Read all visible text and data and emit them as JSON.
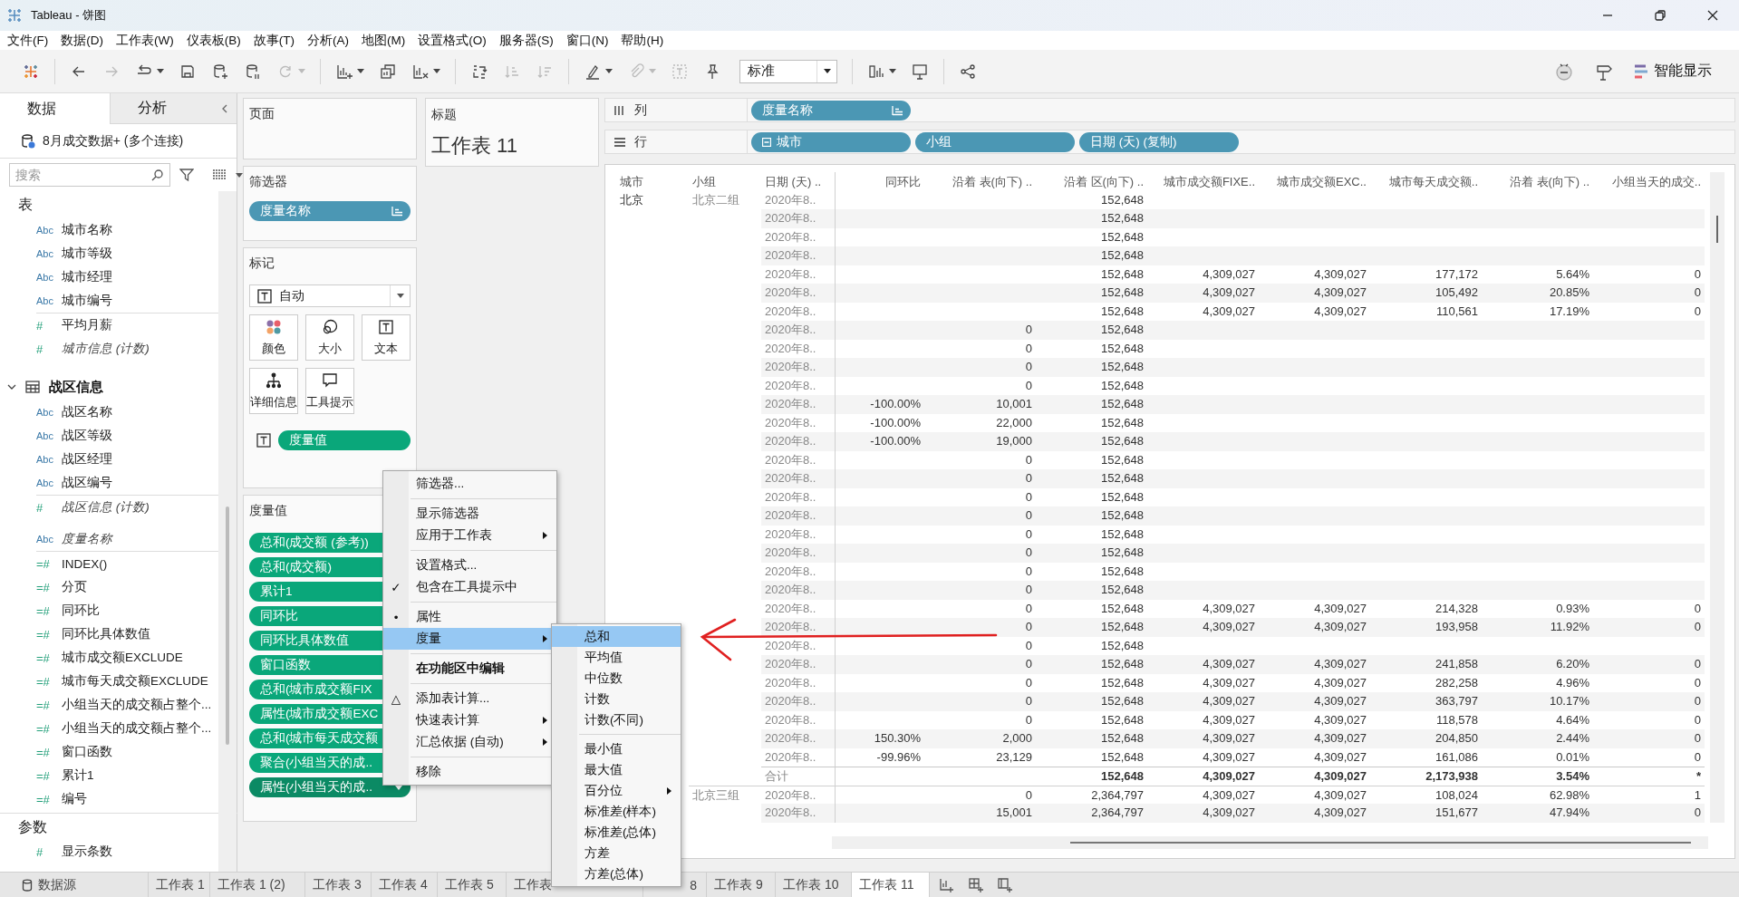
{
  "window": {
    "title": "Tableau - 饼图"
  },
  "menu": [
    "文件(F)",
    "数据(D)",
    "工作表(W)",
    "仪表板(B)",
    "故事(T)",
    "分析(A)",
    "地图(M)",
    "设置格式(O)",
    "服务器(S)",
    "窗口(N)",
    "帮助(H)"
  ],
  "toolbar": {
    "buttons": [
      {
        "disabled": false
      },
      {
        "disabled": true
      },
      {
        "disabled": false
      },
      {
        "disabled": false
      },
      {
        "disabled": false
      },
      {
        "disabled": false
      },
      {
        "disabled": true
      },
      {
        "disabled": false
      },
      {
        "disabled": false
      },
      {
        "disabled": false
      },
      {
        "disabled": false
      },
      {
        "disabled": true
      },
      {
        "disabled": true
      },
      {
        "disabled": false
      },
      {
        "disabled": true
      },
      {
        "disabled": true
      },
      {
        "disabled": false
      },
      {
        "disabled": false
      },
      {
        "disabled": false
      },
      {
        "disabled": false
      }
    ],
    "fit": "标准",
    "show_me": "智能显示"
  },
  "data_pane": {
    "tabs": [
      {
        "label": "数据",
        "selected": true
      },
      {
        "label": "分析",
        "selected": false
      }
    ],
    "source": "8月成交数据+ (多个连接)",
    "search": {
      "placeholder": "搜索"
    },
    "sections": [
      {
        "kind": "heading",
        "title": "表",
        "groups": [
          [
            {
              "icon": "Abc",
              "label": "城市名称",
              "kind": "dimension",
              "generated": false
            },
            {
              "icon": "Abc",
              "label": "城市等级",
              "kind": "dimension",
              "generated": false
            },
            {
              "icon": "Abc",
              "label": "城市经理",
              "kind": "dimension",
              "generated": false
            },
            {
              "icon": "Abc",
              "label": "城市编号",
              "kind": "dimension",
              "generated": false
            }
          ],
          [
            {
              "icon": "#",
              "label": "平均月薪",
              "kind": "measure",
              "generated": false
            },
            {
              "icon": "#",
              "label": "城市信息 (计数)",
              "kind": "measure",
              "generated": true
            }
          ]
        ]
      },
      {
        "kind": "folder",
        "title": "战区信息",
        "expanded": true,
        "groups": [
          [
            {
              "icon": "Abc",
              "label": "战区名称",
              "kind": "dimension",
              "generated": false
            },
            {
              "icon": "Abc",
              "label": "战区等级",
              "kind": "dimension",
              "generated": false
            },
            {
              "icon": "Abc",
              "label": "战区经理",
              "kind": "dimension",
              "generated": false
            },
            {
              "icon": "Abc",
              "label": "战区编号",
              "kind": "dimension",
              "generated": false
            }
          ],
          [
            {
              "icon": "#",
              "label": "战区信息 (计数)",
              "kind": "measure",
              "generated": true
            }
          ]
        ]
      },
      {
        "kind": "plain",
        "groups": [
          [
            {
              "icon": "Abc",
              "label": "度量名称",
              "kind": "dimension",
              "generated": true
            }
          ],
          [
            {
              "icon": "=#",
              "label": "INDEX()",
              "kind": "measure",
              "generated": false
            },
            {
              "icon": "=#",
              "label": "分页",
              "kind": "measure",
              "generated": false
            },
            {
              "icon": "=#",
              "label": "同环比",
              "kind": "measure",
              "generated": false
            },
            {
              "icon": "=#",
              "label": "同环比具体数值",
              "kind": "measure",
              "generated": false
            },
            {
              "icon": "=#",
              "label": "城市成交额EXCLUDE",
              "kind": "measure",
              "generated": false
            },
            {
              "icon": "=#",
              "label": "城市每天成交额EXCLUDE",
              "kind": "measure",
              "generated": false
            },
            {
              "icon": "=#",
              "label": "小组当天的成交额占整个...",
              "kind": "measure",
              "generated": false
            },
            {
              "icon": "=#",
              "label": "小组当天的成交额占整个...",
              "kind": "measure",
              "generated": false
            },
            {
              "icon": "=#",
              "label": "窗口函数",
              "kind": "measure",
              "generated": false
            },
            {
              "icon": "=#",
              "label": "累计1",
              "kind": "measure",
              "generated": false
            },
            {
              "icon": "=#",
              "label": "编号",
              "kind": "measure",
              "generated": false
            }
          ]
        ]
      },
      {
        "kind": "heading",
        "title": "参数",
        "groups": [
          [
            {
              "icon": "#",
              "label": "显示条数",
              "kind": "measure",
              "generated": false
            }
          ]
        ]
      }
    ]
  },
  "shelf_cards": {
    "pages": {
      "title": "页面"
    },
    "filters": {
      "title": "筛选器",
      "pills": [
        {
          "label": "度量名称",
          "kind": "discrete",
          "sorted": true
        }
      ]
    },
    "marks": {
      "title": "标记",
      "mark_type": "自动",
      "buttons": [
        {
          "label": "颜色",
          "kind": "color"
        },
        {
          "label": "大小",
          "kind": "size"
        },
        {
          "label": "文本",
          "kind": "text"
        },
        {
          "label": "详细信息",
          "kind": "detail"
        },
        {
          "label": "工具提示",
          "kind": "tooltip"
        }
      ],
      "encodings": [
        {
          "label": "度量值",
          "kind": "continuous"
        }
      ]
    },
    "measure_values": {
      "title": "度量值",
      "pills": [
        {
          "label": "总和(成交额 (参考))",
          "kind": "continuous",
          "selected": false
        },
        {
          "label": "总和(成交额)",
          "kind": "continuous",
          "selected": false
        },
        {
          "label": "累计1",
          "kind": "continuous",
          "selected": false
        },
        {
          "label": "同环比",
          "kind": "continuous",
          "selected": false
        },
        {
          "label": "同环比具体数值",
          "kind": "continuous",
          "selected": false
        },
        {
          "label": "窗口函数",
          "kind": "continuous",
          "selected": false
        },
        {
          "label": "总和(城市成交额FIX",
          "kind": "continuous",
          "selected": false
        },
        {
          "label": "属性(城市成交额EXC",
          "kind": "continuous",
          "selected": false
        },
        {
          "label": "总和(城市每天成交额",
          "kind": "continuous",
          "selected": false
        },
        {
          "label": "聚合(小组当天的成..",
          "kind": "continuous",
          "selected": false
        },
        {
          "label": "属性(小组当天的成..",
          "kind": "continuous",
          "selected": true
        }
      ]
    },
    "title_card": {
      "title": "标题",
      "text": "工作表 11"
    }
  },
  "shelves": [
    {
      "kind": "columns",
      "label": "列",
      "pills": [
        {
          "label": "度量名称",
          "kind": "discrete",
          "sorted": true
        }
      ]
    },
    {
      "kind": "rows",
      "label": "行",
      "pills": [
        {
          "label": "城市",
          "kind": "discrete",
          "collapsible": true
        },
        {
          "label": "小组",
          "kind": "discrete"
        },
        {
          "label": "日期 (天) (复制)",
          "kind": "discrete"
        }
      ]
    }
  ],
  "table": {
    "columns": [
      "城市",
      "小组",
      "日期 (天) ..",
      "同环比",
      "沿着 表(向下) ..",
      "沿着 区(向下) ..",
      "城市成交额FIXE..",
      "城市成交额EXC..",
      "城市每天成交额..",
      "沿着 表(向下) ..",
      "小组当天的成交.."
    ],
    "rows": [
      {
        "kind": "data",
        "cells": [
          "北京",
          "北京二组",
          "2020年8..",
          null,
          null,
          "152,648",
          null,
          null,
          null,
          null,
          null
        ]
      },
      {
        "kind": "data",
        "cells": [
          null,
          null,
          "2020年8..",
          null,
          null,
          "152,648",
          null,
          null,
          null,
          null,
          null
        ]
      },
      {
        "kind": "data",
        "cells": [
          null,
          null,
          "2020年8..",
          null,
          null,
          "152,648",
          null,
          null,
          null,
          null,
          null
        ]
      },
      {
        "kind": "data",
        "cells": [
          null,
          null,
          "2020年8..",
          null,
          null,
          "152,648",
          null,
          null,
          null,
          null,
          null
        ]
      },
      {
        "kind": "data",
        "cells": [
          null,
          null,
          "2020年8..",
          null,
          null,
          "152,648",
          "4,309,027",
          "4,309,027",
          "177,172",
          "5.64%",
          "0"
        ]
      },
      {
        "kind": "data",
        "cells": [
          null,
          null,
          "2020年8..",
          null,
          null,
          "152,648",
          "4,309,027",
          "4,309,027",
          "105,492",
          "20.85%",
          "0"
        ]
      },
      {
        "kind": "data",
        "cells": [
          null,
          null,
          "2020年8..",
          null,
          null,
          "152,648",
          "4,309,027",
          "4,309,027",
          "110,561",
          "17.19%",
          "0"
        ]
      },
      {
        "kind": "data",
        "cells": [
          null,
          null,
          "2020年8..",
          null,
          "0",
          "152,648",
          null,
          null,
          null,
          null,
          null
        ]
      },
      {
        "kind": "data",
        "cells": [
          null,
          null,
          "2020年8..",
          null,
          "0",
          "152,648",
          null,
          null,
          null,
          null,
          null
        ]
      },
      {
        "kind": "data",
        "cells": [
          null,
          null,
          "2020年8..",
          null,
          "0",
          "152,648",
          null,
          null,
          null,
          null,
          null
        ]
      },
      {
        "kind": "data",
        "cells": [
          null,
          null,
          "2020年8..",
          null,
          "0",
          "152,648",
          null,
          null,
          null,
          null,
          null
        ]
      },
      {
        "kind": "data",
        "cells": [
          null,
          null,
          "2020年8..",
          "-100.00%",
          "10,001",
          "152,648",
          null,
          null,
          null,
          null,
          null
        ]
      },
      {
        "kind": "data",
        "cells": [
          null,
          null,
          "2020年8..",
          "-100.00%",
          "22,000",
          "152,648",
          null,
          null,
          null,
          null,
          null
        ]
      },
      {
        "kind": "data",
        "cells": [
          null,
          null,
          "2020年8..",
          "-100.00%",
          "19,000",
          "152,648",
          null,
          null,
          null,
          null,
          null
        ]
      },
      {
        "kind": "data",
        "cells": [
          null,
          null,
          "2020年8..",
          null,
          "0",
          "152,648",
          null,
          null,
          null,
          null,
          null
        ]
      },
      {
        "kind": "data",
        "cells": [
          null,
          null,
          "2020年8..",
          null,
          "0",
          "152,648",
          null,
          null,
          null,
          null,
          null
        ]
      },
      {
        "kind": "data",
        "cells": [
          null,
          null,
          "2020年8..",
          null,
          "0",
          "152,648",
          null,
          null,
          null,
          null,
          null
        ]
      },
      {
        "kind": "data",
        "cells": [
          null,
          null,
          "2020年8..",
          null,
          "0",
          "152,648",
          null,
          null,
          null,
          null,
          null
        ]
      },
      {
        "kind": "data",
        "cells": [
          null,
          null,
          "2020年8..",
          null,
          "0",
          "152,648",
          null,
          null,
          null,
          null,
          null
        ]
      },
      {
        "kind": "data",
        "cells": [
          null,
          null,
          "2020年8..",
          null,
          "0",
          "152,648",
          null,
          null,
          null,
          null,
          null
        ]
      },
      {
        "kind": "data",
        "cells": [
          null,
          null,
          "2020年8..",
          null,
          "0",
          "152,648",
          null,
          null,
          null,
          null,
          null
        ]
      },
      {
        "kind": "data",
        "cells": [
          null,
          null,
          "2020年8..",
          null,
          "0",
          "152,648",
          null,
          null,
          null,
          null,
          null
        ]
      },
      {
        "kind": "data",
        "cells": [
          null,
          null,
          "2020年8..",
          null,
          "0",
          "152,648",
          "4,309,027",
          "4,309,027",
          "214,328",
          "0.93%",
          "0"
        ]
      },
      {
        "kind": "data",
        "cells": [
          null,
          null,
          "2020年8..",
          null,
          "0",
          "152,648",
          "4,309,027",
          "4,309,027",
          "193,958",
          "11.92%",
          "0"
        ]
      },
      {
        "kind": "data",
        "cells": [
          null,
          null,
          "2020年8..",
          null,
          "0",
          "152,648",
          null,
          null,
          null,
          null,
          null
        ]
      },
      {
        "kind": "data",
        "cells": [
          null,
          null,
          "2020年8..",
          null,
          "0",
          "152,648",
          "4,309,027",
          "4,309,027",
          "241,858",
          "6.20%",
          "0"
        ]
      },
      {
        "kind": "data",
        "cells": [
          null,
          null,
          "2020年8..",
          null,
          "0",
          "152,648",
          "4,309,027",
          "4,309,027",
          "282,258",
          "4.96%",
          "0"
        ]
      },
      {
        "kind": "data",
        "cells": [
          null,
          null,
          "2020年8..",
          null,
          "0",
          "152,648",
          "4,309,027",
          "4,309,027",
          "363,797",
          "10.17%",
          "0"
        ]
      },
      {
        "kind": "data",
        "cells": [
          null,
          null,
          "2020年8..",
          null,
          "0",
          "152,648",
          "4,309,027",
          "4,309,027",
          "118,578",
          "4.64%",
          "0"
        ]
      },
      {
        "kind": "data",
        "cells": [
          null,
          null,
          "2020年8..",
          "150.30%",
          "2,000",
          "152,648",
          "4,309,027",
          "4,309,027",
          "204,850",
          "2.44%",
          "0"
        ]
      },
      {
        "kind": "data",
        "cells": [
          null,
          null,
          "2020年8..",
          "-99.96%",
          "23,129",
          "152,648",
          "4,309,027",
          "4,309,027",
          "161,086",
          "0.01%",
          "0"
        ]
      },
      {
        "kind": "total",
        "cells": [
          null,
          null,
          "合计",
          null,
          null,
          "152,648",
          "4,309,027",
          "4,309,027",
          "2,173,938",
          "3.54%",
          "*"
        ]
      },
      {
        "kind": "data",
        "cells": [
          null,
          "北京三组",
          "2020年8..",
          null,
          "0",
          "2,364,797",
          "4,309,027",
          "4,309,027",
          "108,024",
          "62.98%",
          "1"
        ]
      },
      {
        "kind": "data",
        "cells": [
          null,
          null,
          "2020年8..",
          null,
          "15,001",
          "2,364,797",
          "4,309,027",
          "4,309,027",
          "151,677",
          "47.94%",
          "0"
        ]
      }
    ]
  },
  "context_menu": {
    "groups": [
      [
        {
          "label": "筛选器...",
          "selected": false
        }
      ],
      [
        {
          "label": "显示筛选器",
          "selected": false
        },
        {
          "label": "应用于工作表",
          "selected": false,
          "submenu": true
        }
      ],
      [
        {
          "label": "设置格式...",
          "selected": false
        },
        {
          "label": "包含在工具提示中",
          "selected": false,
          "icon": "✓"
        }
      ],
      [
        {
          "label": "属性",
          "selected": false,
          "icon": "•"
        },
        {
          "label": "度量",
          "selected": true,
          "submenu": true
        }
      ],
      [
        {
          "label": "在功能区中编辑",
          "selected": false,
          "bold": true
        }
      ],
      [
        {
          "label": "添加表计算...",
          "selected": false,
          "icon": "△"
        },
        {
          "label": "快速表计算",
          "selected": false,
          "submenu": true
        },
        {
          "label": "汇总依据 (自动)",
          "selected": false,
          "submenu": true
        }
      ],
      [
        {
          "label": "移除",
          "selected": false
        }
      ]
    ]
  },
  "submenu": {
    "groups": [
      [
        {
          "label": "总和",
          "selected": true
        },
        {
          "label": "平均值",
          "selected": false
        },
        {
          "label": "中位数",
          "selected": false
        },
        {
          "label": "计数",
          "selected": false
        },
        {
          "label": "计数(不同)",
          "selected": false
        }
      ],
      [
        {
          "label": "最小值",
          "selected": false
        },
        {
          "label": "最大值",
          "selected": false
        },
        {
          "label": "百分位",
          "selected": false,
          "submenu": true
        },
        {
          "label": "标准差(样本)",
          "selected": false
        },
        {
          "label": "标准差(总体)",
          "selected": false
        },
        {
          "label": "方差",
          "selected": false
        },
        {
          "label": "方差(总体)",
          "selected": false
        }
      ]
    ]
  },
  "sheet_tabs": [
    {
      "label": "数据源",
      "kind": "datasource",
      "selected": false
    },
    {
      "label": "工作表 1",
      "kind": "sheet",
      "selected": false
    },
    {
      "label": "工作表 1 (2)",
      "kind": "sheet",
      "selected": false
    },
    {
      "label": "工作表 3",
      "kind": "sheet",
      "selected": false
    },
    {
      "label": "工作表 4",
      "kind": "sheet",
      "selected": false
    },
    {
      "label": "工作表 5",
      "kind": "sheet",
      "selected": false
    },
    {
      "label": "工作表",
      "kind": "sheet-clipped",
      "selected": false
    },
    {
      "label": "8",
      "kind": "sheet-tail",
      "selected": false
    },
    {
      "label": "工作表 9",
      "kind": "sheet",
      "selected": false
    },
    {
      "label": "工作表 10",
      "kind": "sheet",
      "selected": false
    },
    {
      "label": "工作表 11",
      "kind": "sheet",
      "selected": true
    }
  ]
}
